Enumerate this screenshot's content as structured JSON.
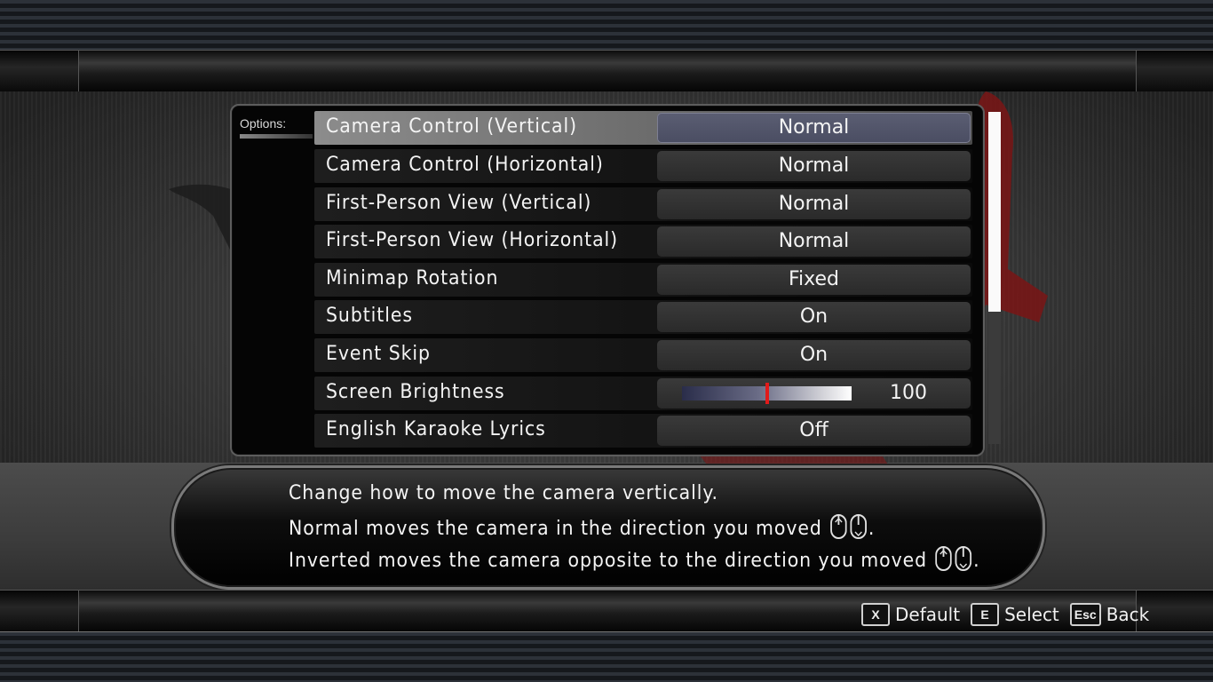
{
  "panel": {
    "tab_label": "Options:"
  },
  "options": [
    {
      "label": "Camera Control (Vertical)",
      "value": "Normal"
    },
    {
      "label": "Camera Control (Horizontal)",
      "value": "Normal"
    },
    {
      "label": "First-Person View (Vertical)",
      "value": "Normal"
    },
    {
      "label": "First-Person View (Horizontal)",
      "value": "Normal"
    },
    {
      "label": "Minimap Rotation",
      "value": "Fixed"
    },
    {
      "label": "Subtitles",
      "value": "On"
    },
    {
      "label": "Event Skip",
      "value": "On"
    },
    {
      "label": "Screen Brightness",
      "value": "100"
    },
    {
      "label": "English Karaoke Lyrics",
      "value": "Off"
    }
  ],
  "brightness": {
    "level_fraction": 0.5
  },
  "description": {
    "line1": "Change how to move the camera vertically.",
    "line2": "Normal moves the camera in the direction you moved",
    "line3": "Inverted moves the camera opposite to the direction you moved",
    "period": "."
  },
  "controls": [
    {
      "key": "X",
      "label": "Default"
    },
    {
      "key": "E",
      "label": "Select"
    },
    {
      "key": "Esc",
      "label": "Back"
    }
  ],
  "colors": {
    "selected_value_bg": "#5b5e73",
    "slider_marker": "#e21a1a",
    "emblem_red": "#7a1515"
  },
  "icons": [
    "mouse-up-icon",
    "mouse-down-icon"
  ]
}
